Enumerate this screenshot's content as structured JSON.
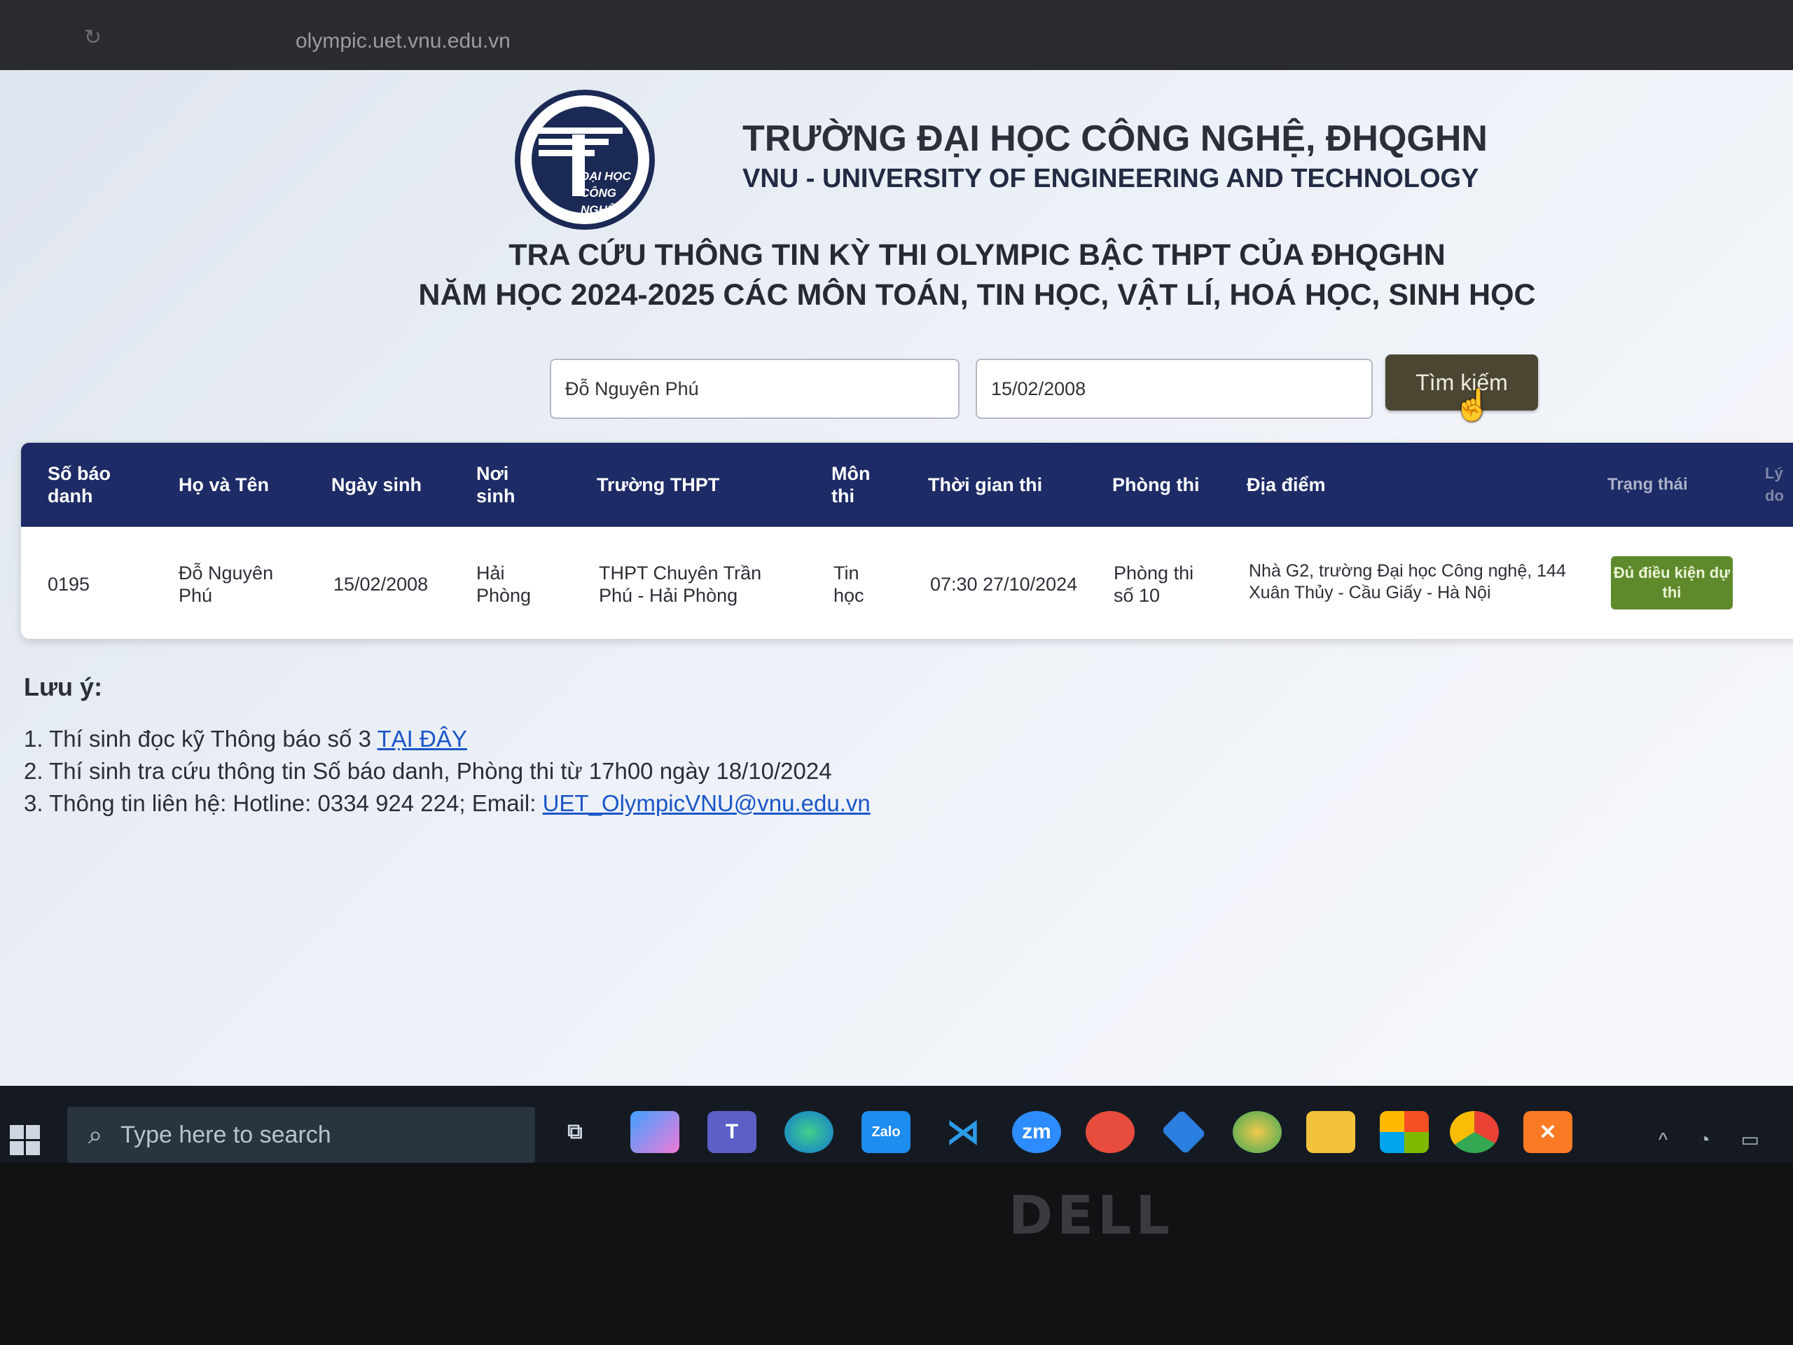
{
  "browser": {
    "url": "olympic.uet.vnu.edu.vn"
  },
  "header": {
    "logo_text_line1": "ĐẠI HỌC",
    "logo_text_line2": "CÔNG NGHỆ",
    "uni_vn": "TRƯỜNG ĐẠI HỌC CÔNG NGHỆ, ĐHQGHN",
    "uni_en": "VNU - UNIVERSITY OF ENGINEERING AND TECHNOLOGY",
    "title_line1": "TRA CỨU THÔNG TIN KỲ THI OLYMPIC BẬC THPT CỦA ĐHQGHN",
    "title_line2": "NĂM HỌC 2024-2025 CÁC MÔN TOÁN, TIN HỌC, VẬT LÍ, HOÁ HỌC, SINH HỌC"
  },
  "search": {
    "name_value": "Đỗ Nguyên Phú",
    "dob_value": "15/02/2008",
    "button_label": "Tìm kiếm"
  },
  "table": {
    "headers": [
      "Số báo danh",
      "Họ và Tên",
      "Ngày sinh",
      "Nơi sinh",
      "Trường THPT",
      "Môn thi",
      "Thời gian thi",
      "Phòng thi",
      "Địa điểm",
      "Trạng thái",
      "Lý do"
    ],
    "row": {
      "sbd": "0195",
      "name": "Đỗ Nguyên Phú",
      "dob": "15/02/2008",
      "birthplace": "Hải Phòng",
      "school": "THPT Chuyên Trần Phú - Hải Phòng",
      "subject": "Tin học",
      "time": "07:30 27/10/2024",
      "room": "Phòng thi số 10",
      "location": "Nhà G2, trường Đại học Công nghệ, 144 Xuân Thủy - Cầu Giấy - Hà Nội",
      "status": "Đủ điều kiện dự thi"
    }
  },
  "notes": {
    "heading": "Lưu ý:",
    "n1_text": "1. Thí sinh đọc kỹ Thông báo số 3 ",
    "n1_link": "TẠI ĐÂY",
    "n2_text": "2. Thí sinh tra cứu thông tin Số báo danh, Phòng thi từ 17h00 ngày 18/10/2024",
    "n3_text": "3. Thông tin liên hệ: Hotline: 0334 924 224; Email: ",
    "n3_link": "UET_OlympicVNU@vnu.edu.vn"
  },
  "taskbar": {
    "search_placeholder": "Type here to search",
    "icons": [
      "task-view-icon",
      "copilot-icon",
      "teams-icon",
      "edge-icon",
      "zalo-icon",
      "vscode-icon",
      "zoom-icon",
      "recorder-icon",
      "app-icon",
      "chrome-canary-icon",
      "file-explorer-icon",
      "store-icon",
      "chrome-icon",
      "xampp-icon"
    ],
    "zalo_label": "Zalo",
    "zoom_label": "zm"
  },
  "bezel": {
    "brand": "DELL"
  }
}
